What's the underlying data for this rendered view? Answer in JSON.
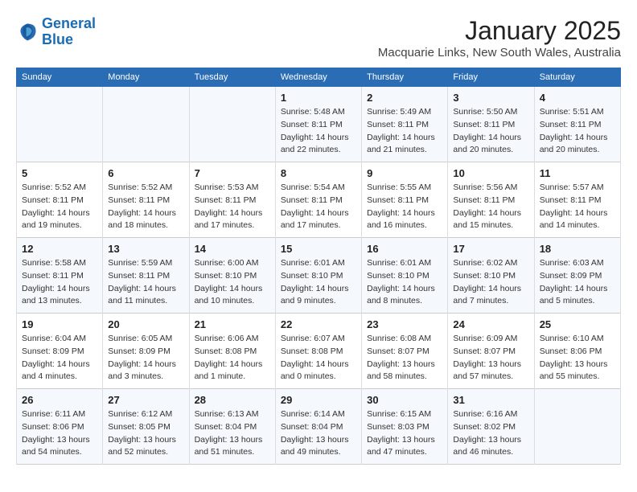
{
  "logo": {
    "line1": "General",
    "line2": "Blue"
  },
  "title": "January 2025",
  "subtitle": "Macquarie Links, New South Wales, Australia",
  "weekdays": [
    "Sunday",
    "Monday",
    "Tuesday",
    "Wednesday",
    "Thursday",
    "Friday",
    "Saturday"
  ],
  "weeks": [
    [
      {
        "day": "",
        "info": ""
      },
      {
        "day": "",
        "info": ""
      },
      {
        "day": "",
        "info": ""
      },
      {
        "day": "1",
        "info": "Sunrise: 5:48 AM\nSunset: 8:11 PM\nDaylight: 14 hours\nand 22 minutes."
      },
      {
        "day": "2",
        "info": "Sunrise: 5:49 AM\nSunset: 8:11 PM\nDaylight: 14 hours\nand 21 minutes."
      },
      {
        "day": "3",
        "info": "Sunrise: 5:50 AM\nSunset: 8:11 PM\nDaylight: 14 hours\nand 20 minutes."
      },
      {
        "day": "4",
        "info": "Sunrise: 5:51 AM\nSunset: 8:11 PM\nDaylight: 14 hours\nand 20 minutes."
      }
    ],
    [
      {
        "day": "5",
        "info": "Sunrise: 5:52 AM\nSunset: 8:11 PM\nDaylight: 14 hours\nand 19 minutes."
      },
      {
        "day": "6",
        "info": "Sunrise: 5:52 AM\nSunset: 8:11 PM\nDaylight: 14 hours\nand 18 minutes."
      },
      {
        "day": "7",
        "info": "Sunrise: 5:53 AM\nSunset: 8:11 PM\nDaylight: 14 hours\nand 17 minutes."
      },
      {
        "day": "8",
        "info": "Sunrise: 5:54 AM\nSunset: 8:11 PM\nDaylight: 14 hours\nand 17 minutes."
      },
      {
        "day": "9",
        "info": "Sunrise: 5:55 AM\nSunset: 8:11 PM\nDaylight: 14 hours\nand 16 minutes."
      },
      {
        "day": "10",
        "info": "Sunrise: 5:56 AM\nSunset: 8:11 PM\nDaylight: 14 hours\nand 15 minutes."
      },
      {
        "day": "11",
        "info": "Sunrise: 5:57 AM\nSunset: 8:11 PM\nDaylight: 14 hours\nand 14 minutes."
      }
    ],
    [
      {
        "day": "12",
        "info": "Sunrise: 5:58 AM\nSunset: 8:11 PM\nDaylight: 14 hours\nand 13 minutes."
      },
      {
        "day": "13",
        "info": "Sunrise: 5:59 AM\nSunset: 8:11 PM\nDaylight: 14 hours\nand 11 minutes."
      },
      {
        "day": "14",
        "info": "Sunrise: 6:00 AM\nSunset: 8:10 PM\nDaylight: 14 hours\nand 10 minutes."
      },
      {
        "day": "15",
        "info": "Sunrise: 6:01 AM\nSunset: 8:10 PM\nDaylight: 14 hours\nand 9 minutes."
      },
      {
        "day": "16",
        "info": "Sunrise: 6:01 AM\nSunset: 8:10 PM\nDaylight: 14 hours\nand 8 minutes."
      },
      {
        "day": "17",
        "info": "Sunrise: 6:02 AM\nSunset: 8:10 PM\nDaylight: 14 hours\nand 7 minutes."
      },
      {
        "day": "18",
        "info": "Sunrise: 6:03 AM\nSunset: 8:09 PM\nDaylight: 14 hours\nand 5 minutes."
      }
    ],
    [
      {
        "day": "19",
        "info": "Sunrise: 6:04 AM\nSunset: 8:09 PM\nDaylight: 14 hours\nand 4 minutes."
      },
      {
        "day": "20",
        "info": "Sunrise: 6:05 AM\nSunset: 8:09 PM\nDaylight: 14 hours\nand 3 minutes."
      },
      {
        "day": "21",
        "info": "Sunrise: 6:06 AM\nSunset: 8:08 PM\nDaylight: 14 hours\nand 1 minute."
      },
      {
        "day": "22",
        "info": "Sunrise: 6:07 AM\nSunset: 8:08 PM\nDaylight: 14 hours\nand 0 minutes."
      },
      {
        "day": "23",
        "info": "Sunrise: 6:08 AM\nSunset: 8:07 PM\nDaylight: 13 hours\nand 58 minutes."
      },
      {
        "day": "24",
        "info": "Sunrise: 6:09 AM\nSunset: 8:07 PM\nDaylight: 13 hours\nand 57 minutes."
      },
      {
        "day": "25",
        "info": "Sunrise: 6:10 AM\nSunset: 8:06 PM\nDaylight: 13 hours\nand 55 minutes."
      }
    ],
    [
      {
        "day": "26",
        "info": "Sunrise: 6:11 AM\nSunset: 8:06 PM\nDaylight: 13 hours\nand 54 minutes."
      },
      {
        "day": "27",
        "info": "Sunrise: 6:12 AM\nSunset: 8:05 PM\nDaylight: 13 hours\nand 52 minutes."
      },
      {
        "day": "28",
        "info": "Sunrise: 6:13 AM\nSunset: 8:04 PM\nDaylight: 13 hours\nand 51 minutes."
      },
      {
        "day": "29",
        "info": "Sunrise: 6:14 AM\nSunset: 8:04 PM\nDaylight: 13 hours\nand 49 minutes."
      },
      {
        "day": "30",
        "info": "Sunrise: 6:15 AM\nSunset: 8:03 PM\nDaylight: 13 hours\nand 47 minutes."
      },
      {
        "day": "31",
        "info": "Sunrise: 6:16 AM\nSunset: 8:02 PM\nDaylight: 13 hours\nand 46 minutes."
      },
      {
        "day": "",
        "info": ""
      }
    ]
  ]
}
